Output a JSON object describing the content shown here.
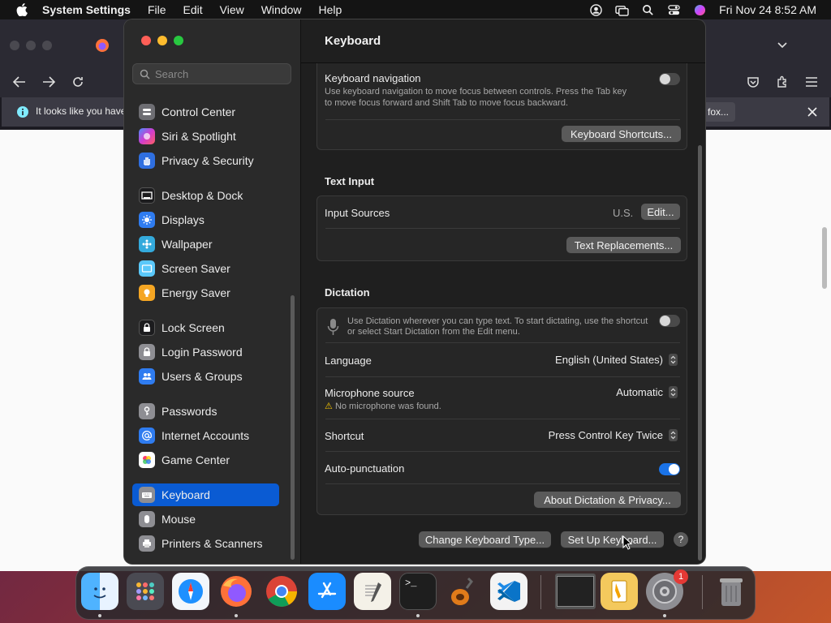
{
  "menubar": {
    "app_name": "System Settings",
    "menus": [
      "File",
      "Edit",
      "View",
      "Window",
      "Help"
    ],
    "clock": "Fri Nov 24  8:52 AM"
  },
  "firefox_bg": {
    "notice_text": "It looks like you have",
    "notice_right": "fox..."
  },
  "search": {
    "placeholder": "Search"
  },
  "sidebar": {
    "items": [
      {
        "label": "Control Center",
        "icon": "control-center-icon",
        "color": "#6e6e73"
      },
      {
        "label": "Siri & Spotlight",
        "icon": "siri-icon",
        "color": "#c039d8"
      },
      {
        "label": "Privacy & Security",
        "icon": "hand-icon",
        "color": "#2f6fe0"
      },
      {
        "label": "Desktop & Dock",
        "icon": "desktop-icon",
        "color": "#1c1c1e"
      },
      {
        "label": "Displays",
        "icon": "sun-icon",
        "color": "#2f7cf0"
      },
      {
        "label": "Wallpaper",
        "icon": "wallpaper-icon",
        "color": "#34aadc"
      },
      {
        "label": "Screen Saver",
        "icon": "screensaver-icon",
        "color": "#5ac8fa"
      },
      {
        "label": "Energy Saver",
        "icon": "bulb-icon",
        "color": "#f5a623"
      },
      {
        "label": "Lock Screen",
        "icon": "lock-icon",
        "color": "#1c1c1e"
      },
      {
        "label": "Login Password",
        "icon": "padlock-icon",
        "color": "#8e8e93"
      },
      {
        "label": "Users & Groups",
        "icon": "users-icon",
        "color": "#2f7cf0"
      },
      {
        "label": "Passwords",
        "icon": "key-icon",
        "color": "#8e8e93"
      },
      {
        "label": "Internet Accounts",
        "icon": "at-icon",
        "color": "#2f7cf0"
      },
      {
        "label": "Game Center",
        "icon": "game-center-icon",
        "color": "#ffffff"
      },
      {
        "label": "Keyboard",
        "icon": "keyboard-icon",
        "color": "#8e8e93"
      },
      {
        "label": "Mouse",
        "icon": "mouse-icon",
        "color": "#8e8e93"
      },
      {
        "label": "Printers & Scanners",
        "icon": "printer-icon",
        "color": "#8e8e93"
      }
    ],
    "selected": "Keyboard"
  },
  "main": {
    "title": "Keyboard",
    "keyboard_navigation": {
      "label": "Keyboard navigation",
      "desc1": "Use keyboard navigation to move focus between controls. Press the Tab key",
      "desc2": "to move focus forward and Shift Tab to move focus backward.",
      "enabled": false,
      "shortcuts_button": "Keyboard Shortcuts..."
    },
    "text_input": {
      "header": "Text Input",
      "input_sources_label": "Input Sources",
      "input_sources_value": "U.S.",
      "edit_button": "Edit...",
      "replacements_button": "Text Replacements..."
    },
    "dictation": {
      "header": "Dictation",
      "desc1": "Use Dictation wherever you can type text. To start dictating, use the shortcut",
      "desc2": "or select Start Dictation from the Edit menu.",
      "enabled": false,
      "language_label": "Language",
      "language_value": "English (United States)",
      "mic_label": "Microphone source",
      "mic_value": "Automatic",
      "mic_warning": "No microphone was found.",
      "shortcut_label": "Shortcut",
      "shortcut_value": "Press Control Key Twice",
      "autopunct_label": "Auto-punctuation",
      "autopunct_enabled": true,
      "about_button": "About Dictation & Privacy..."
    },
    "footer": {
      "change_type_button": "Change Keyboard Type...",
      "setup_button": "Set Up Keyboard...",
      "help": "?"
    }
  },
  "dock": {
    "badge_count": "1"
  }
}
